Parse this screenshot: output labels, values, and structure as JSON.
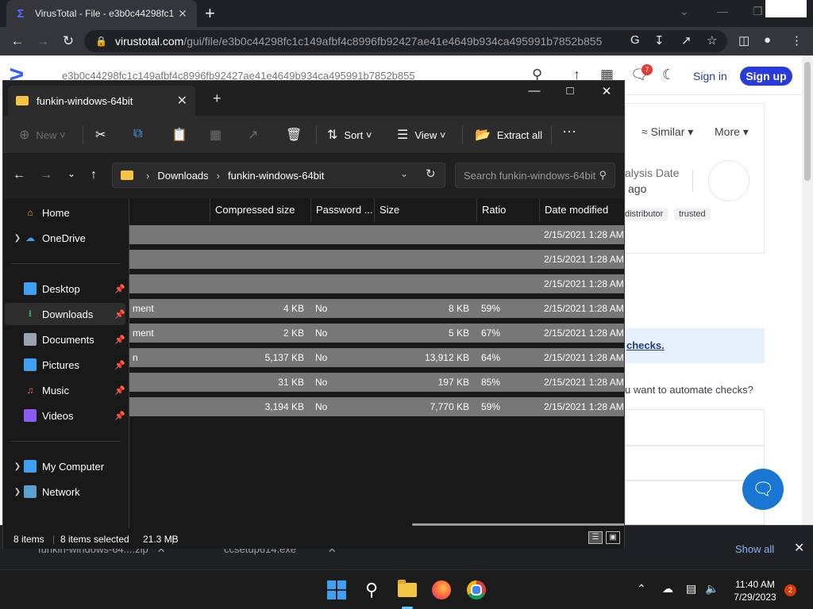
{
  "browser": {
    "tab_title": "VirusTotal - File - e3b0c44298fc1",
    "tab_icon": "virustotal-icon",
    "url_host": "virustotal.com",
    "url_path": "/gui/file/e3b0c44298fc1c149afbf4c8996fb92427ae41e4649b934ca495991b7852b855"
  },
  "vt": {
    "hash": "e3b0c44298fc1c149afbf4c8996fb92427ae41e4649b934ca495991b7852b855",
    "notification_count": "7",
    "sign_in": "Sign in",
    "sign_up": "Sign up",
    "similar": "Similar",
    "more": "More",
    "analysis_date": "alysis Date",
    "ago": "ago",
    "tags": [
      "distributor",
      "trusted"
    ],
    "checks_link": "checks.",
    "automate_text": "u want to automate checks?"
  },
  "downloads": {
    "items": [
      "funkin-windows-64....zip",
      "ccsetup614.exe"
    ],
    "show_all": "Show all"
  },
  "explorer": {
    "tab_title": "funkin-windows-64bit",
    "commands": {
      "new": "New",
      "sort": "Sort",
      "view": "View",
      "extract_all": "Extract all"
    },
    "breadcrumb": [
      "Downloads",
      "funkin-windows-64bit"
    ],
    "search_placeholder": "Search funkin-windows-64bit",
    "sidebar": {
      "home": "Home",
      "onedrive": "OneDrive",
      "desktop": "Desktop",
      "downloads": "Downloads",
      "documents": "Documents",
      "pictures": "Pictures",
      "music": "Music",
      "videos": "Videos",
      "my_computer": "My Computer",
      "network": "Network"
    },
    "columns": {
      "compressed": "Compressed size",
      "password": "Password ...",
      "size": "Size",
      "ratio": "Ratio",
      "date": "Date modified"
    },
    "rows": [
      {
        "name": "",
        "compressed": "",
        "password": "",
        "size": "",
        "ratio": "",
        "date": "2/15/2021 1:28 AM"
      },
      {
        "name": "",
        "compressed": "",
        "password": "",
        "size": "",
        "ratio": "",
        "date": "2/15/2021 1:28 AM"
      },
      {
        "name": "",
        "compressed": "",
        "password": "",
        "size": "",
        "ratio": "",
        "date": "2/15/2021 1:28 AM"
      },
      {
        "name": "ment",
        "compressed": "4 KB",
        "password": "No",
        "size": "8 KB",
        "ratio": "59%",
        "date": "2/15/2021 1:28 AM"
      },
      {
        "name": "ment",
        "compressed": "2 KB",
        "password": "No",
        "size": "5 KB",
        "ratio": "67%",
        "date": "2/15/2021 1:28 AM"
      },
      {
        "name": "n",
        "compressed": "5,137 KB",
        "password": "No",
        "size": "13,912 KB",
        "ratio": "64%",
        "date": "2/15/2021 1:28 AM"
      },
      {
        "name": "",
        "compressed": "31 KB",
        "password": "No",
        "size": "197 KB",
        "ratio": "85%",
        "date": "2/15/2021 1:28 AM"
      },
      {
        "name": "",
        "compressed": "3,194 KB",
        "password": "No",
        "size": "7,770 KB",
        "ratio": "59%",
        "date": "2/15/2021 1:28 AM"
      }
    ],
    "status": {
      "items": "8 items",
      "selected": "8 items selected",
      "size": "21.3 MB"
    }
  },
  "taskbar": {
    "time": "11:40 AM",
    "date": "7/29/2023",
    "notification_count": "2"
  }
}
